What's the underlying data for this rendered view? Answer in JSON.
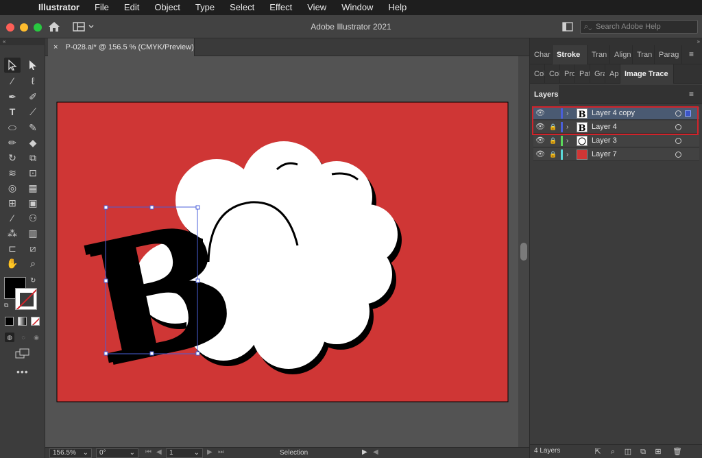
{
  "menubar": {
    "apple": "",
    "items": [
      "Illustrator",
      "File",
      "Edit",
      "Object",
      "Type",
      "Select",
      "Effect",
      "View",
      "Window",
      "Help"
    ]
  },
  "app": {
    "title": "Adobe Illustrator 2021",
    "search_placeholder": "Search Adobe Help"
  },
  "document": {
    "tab_label": "P-028.ai* @ 156.5 % (CMYK/Preview)",
    "tab_close": "×",
    "artboard_color": "#cf3635",
    "letter": "B"
  },
  "panel_tabs_row1": [
    "Char",
    "Stroke",
    "Tran",
    "Align",
    "Tran",
    "Parag"
  ],
  "panel_tabs_row2": [
    "Col",
    "Col",
    "Pro",
    "Pat",
    "Gra",
    "Ap",
    "Image Trace"
  ],
  "layers": {
    "title": "Layers",
    "rows": [
      {
        "name": "Layer 4 copy",
        "color": "#4a5fd8",
        "locked": false,
        "selected": true
      },
      {
        "name": "Layer 4",
        "color": "#4a5fd8",
        "locked": true,
        "selected": false
      },
      {
        "name": "Layer 3",
        "color": "#5bd85b",
        "locked": true,
        "selected": false
      },
      {
        "name": "Layer 7",
        "color": "#5bd8d8",
        "locked": true,
        "selected": false
      }
    ],
    "count": "4 Layers"
  },
  "status": {
    "zoom": "156.5%",
    "rotation": "0°",
    "artboard": "1",
    "tool": "Selection"
  },
  "colors": {
    "accent_highlight": "#d1232a",
    "selection_blue": "#4a5fd8"
  }
}
